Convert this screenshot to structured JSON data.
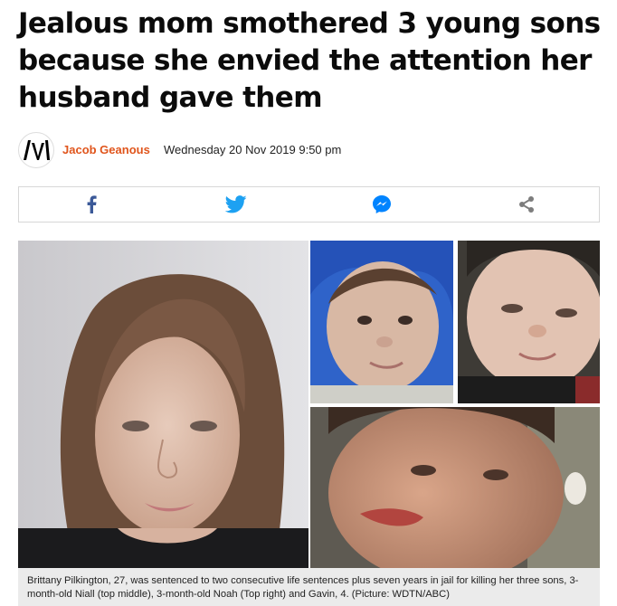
{
  "article": {
    "headline": "Jealous mom smothered 3 young sons because she envied the attention her husband gave them",
    "author": "Jacob Geanous",
    "date": "Wednesday 20 Nov 2019 9:50 pm"
  },
  "share": {
    "items": [
      {
        "name": "facebook",
        "icon": "facebook-icon",
        "color": "#3b5998"
      },
      {
        "name": "twitter",
        "icon": "twitter-bird-icon",
        "color": "#1da1f2"
      },
      {
        "name": "messenger",
        "icon": "messenger-icon",
        "color": "#0084ff"
      },
      {
        "name": "share",
        "icon": "share-nodes-icon",
        "color": "#7d7d7d"
      }
    ]
  },
  "media": {
    "photos": [
      {
        "subject": "mugshot-woman"
      },
      {
        "subject": "baby-top-middle"
      },
      {
        "subject": "baby-top-right"
      },
      {
        "subject": "toddler-bottom"
      }
    ],
    "caption": "Brittany Pilkington, 27, was sentenced to two consecutive life sentences plus seven years in jail for killing her three sons, 3-month-old Niall (top middle), 3-month-old Noah (Top right) and Gavin, 4. (Picture: WDTN/ABC)"
  },
  "colors": {
    "author": "#e0551c",
    "caption_bg": "#ebebeb",
    "border": "#d7d7d7"
  }
}
